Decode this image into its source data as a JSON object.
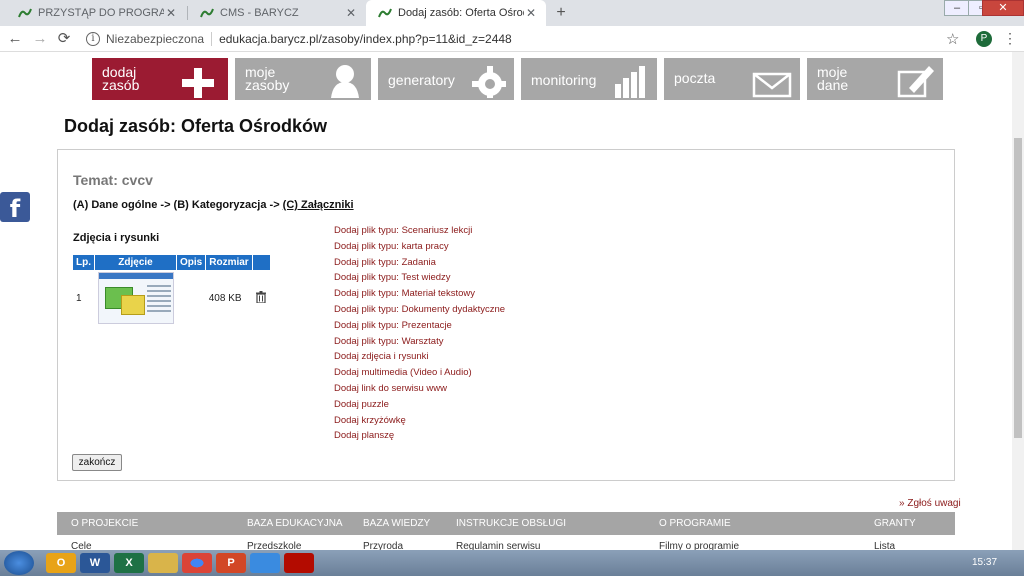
{
  "browser": {
    "tabs": [
      {
        "title": "PRZYSTĄP DO PROGRAMU",
        "close": "✕"
      },
      {
        "title": "CMS - BARYCZ",
        "close": "✕"
      },
      {
        "title": "Dodaj zasób: Oferta Ośrodków",
        "close": "✕"
      }
    ],
    "new_tab": "+",
    "window_controls": {
      "minimize": "–",
      "maximize": "▫",
      "close": "✕"
    },
    "nav": {
      "back": "←",
      "forward": "→",
      "reload": "⟳"
    },
    "omnibox": {
      "info": "i",
      "insecure": "Niezabezpieczona",
      "url": "edukacja.barycz.pl/zasoby/index.php?p=11&id_z=2448"
    },
    "star": "☆",
    "profile": "P",
    "menu": "⋮"
  },
  "topmenu": [
    {
      "line1": "dodaj",
      "line2": "zasób",
      "icon": "plus-icon"
    },
    {
      "line1": "moje",
      "line2": "zasoby",
      "icon": "user-icon"
    },
    {
      "line1": "generatory",
      "line2": "",
      "icon": "gear-icon"
    },
    {
      "line1": "monitoring",
      "line2": "",
      "icon": "bar-chart-icon"
    },
    {
      "line1": "poczta",
      "line2": "",
      "icon": "envelope-icon"
    },
    {
      "line1": "moje",
      "line2": "dane",
      "icon": "edit-icon"
    }
  ],
  "facebook": "f",
  "page_title": "Dodaj zasób: Oferta Ośrodków",
  "temat": "Temat: cvcv",
  "steps": {
    "a": "(A) Dane ogólne",
    "arrow1": " -> ",
    "b": "(B) Kategoryzacja",
    "arrow2": " -> ",
    "c": "(C) Załączniki"
  },
  "section_title": "Zdjęcia i rysunki",
  "table": {
    "headers": [
      "Lp.",
      "Zdjęcie",
      "Opis",
      "Rozmiar"
    ],
    "rows": [
      {
        "lp": "1",
        "size": "408 KB"
      }
    ]
  },
  "links": [
    "Dodaj plik typu: Scenariusz lekcji",
    "Dodaj plik typu: karta pracy",
    "Dodaj plik typu: Zadania",
    "Dodaj plik typu: Test wiedzy",
    "Dodaj plik typu: Materiał tekstowy",
    "Dodaj plik typu: Dokumenty dydaktyczne",
    "Dodaj plik typu: Prezentacje",
    "Dodaj plik typu: Warsztaty",
    "Dodaj zdjęcia i rysunki",
    "Dodaj multimedia (Video i Audio)",
    "Dodaj link do serwisu www",
    "Dodaj puzzle",
    "Dodaj krzyżówkę",
    "Dodaj planszę"
  ],
  "finish_button": "zakończ",
  "report": "» Zgłoś uwagi",
  "footer": {
    "columns": [
      "O PROJEKCIE",
      "BAZA EDUKACYJNA",
      "BAZA WIEDZY",
      "INSTRUKCJE OBSŁUGI",
      "O PROGRAMIE",
      "GRANTY"
    ],
    "items": [
      "Cele",
      "Przedszkole",
      "Przyroda",
      "Regulamin serwisu",
      "Filmy o programie",
      "Lista"
    ]
  },
  "taskbar": {
    "apps": [
      "O",
      "W",
      "X",
      "",
      "",
      "P",
      "",
      ""
    ],
    "clock": "15:37"
  },
  "colors": {
    "accent": "#9b1b32",
    "menu_gray": "#a7a7a7",
    "table_header": "#1f6fc5",
    "link": "#8b1a1a"
  }
}
